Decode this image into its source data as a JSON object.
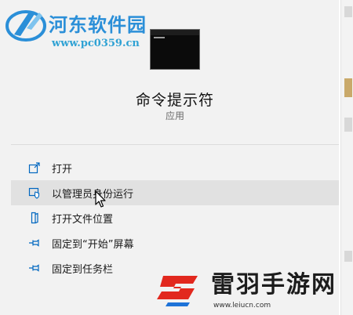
{
  "app": {
    "name": "命令提示符",
    "type": "应用"
  },
  "menu": {
    "items": [
      {
        "label": "打开",
        "icon": "open-icon"
      },
      {
        "label": "以管理员身份运行",
        "icon": "shield-run-icon"
      },
      {
        "label": "打开文件位置",
        "icon": "file-location-icon"
      },
      {
        "label": "固定到“开始”屏幕",
        "icon": "pin-icon"
      },
      {
        "label": "固定到任务栏",
        "icon": "pin-icon"
      }
    ]
  },
  "watermarks": {
    "site_name": "河东软件园",
    "site_url": "www.pc0359.cn",
    "brand_name": "雷羽手游网",
    "brand_url": "www.leiucn.com"
  },
  "colors": {
    "accent": "#0067c0",
    "hover": "#e1e1e1",
    "panel": "#f2f2f2"
  }
}
